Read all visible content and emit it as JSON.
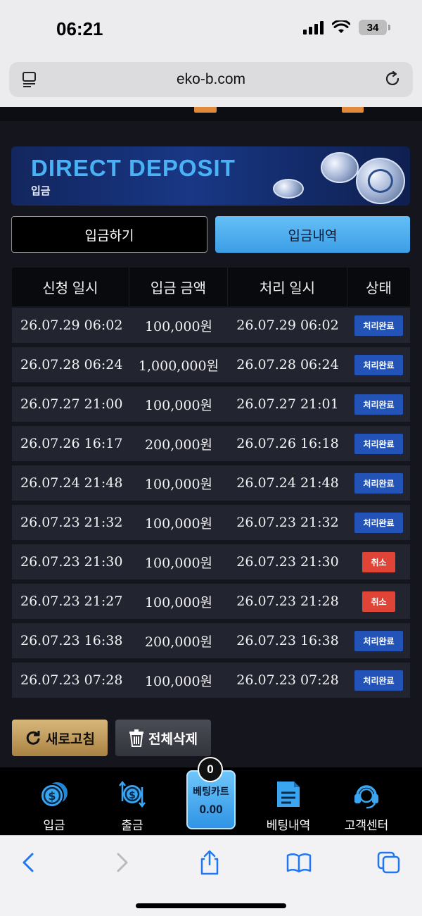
{
  "status_bar": {
    "time": "06:21",
    "battery": "34"
  },
  "browser": {
    "url": "eko-b.com"
  },
  "banner": {
    "title": "DIRECT DEPOSIT",
    "subtitle": "입금"
  },
  "tabs": [
    {
      "label": "입금하기",
      "active": false
    },
    {
      "label": "입금내역",
      "active": true
    }
  ],
  "table": {
    "headers": [
      "신청 일시",
      "입금 금액",
      "처리 일시",
      "상태"
    ],
    "rows": [
      {
        "request": "26.07.29 06:02",
        "amount": "100,000원",
        "processed": "26.07.29 06:02",
        "status": "처리완료",
        "status_type": "done"
      },
      {
        "request": "26.07.28 06:24",
        "amount": "1,000,000원",
        "processed": "26.07.28 06:24",
        "status": "처리완료",
        "status_type": "done"
      },
      {
        "request": "26.07.27 21:00",
        "amount": "100,000원",
        "processed": "26.07.27 21:01",
        "status": "처리완료",
        "status_type": "done"
      },
      {
        "request": "26.07.26 16:17",
        "amount": "200,000원",
        "processed": "26.07.26 16:18",
        "status": "처리완료",
        "status_type": "done"
      },
      {
        "request": "26.07.24 21:48",
        "amount": "100,000원",
        "processed": "26.07.24 21:48",
        "status": "처리완료",
        "status_type": "done"
      },
      {
        "request": "26.07.23 21:32",
        "amount": "100,000원",
        "processed": "26.07.23 21:32",
        "status": "처리완료",
        "status_type": "done"
      },
      {
        "request": "26.07.23 21:30",
        "amount": "100,000원",
        "processed": "26.07.23 21:30",
        "status": "취소",
        "status_type": "cancel"
      },
      {
        "request": "26.07.23 21:27",
        "amount": "100,000원",
        "processed": "26.07.23 21:28",
        "status": "취소",
        "status_type": "cancel"
      },
      {
        "request": "26.07.23 16:38",
        "amount": "200,000원",
        "processed": "26.07.23 16:38",
        "status": "처리완료",
        "status_type": "done"
      },
      {
        "request": "26.07.23 07:28",
        "amount": "100,000원",
        "processed": "26.07.23 07:28",
        "status": "처리완료",
        "status_type": "done"
      }
    ]
  },
  "actions": {
    "refresh_label": "새로고침",
    "delete_all_label": "전체삭제"
  },
  "bottom_nav": {
    "deposit": "입금",
    "withdraw": "출금",
    "cart_label": "베팅카트",
    "cart_value": "0.00",
    "cart_count": "0",
    "bet_history": "베팅내역",
    "support": "고객센터"
  },
  "colors": {
    "done": "#2453b8",
    "cancel": "#df4436",
    "accent": "#49b2f5",
    "gold": "#c9a560"
  },
  "icons": [
    "document-icon",
    "reload-icon",
    "back-icon",
    "forward-icon",
    "share-icon",
    "bookmarks-icon",
    "tabs-icon",
    "dollar-coin-icon",
    "withdraw-icon",
    "receipt-icon",
    "headset-icon",
    "trash-icon",
    "refresh-icon"
  ]
}
